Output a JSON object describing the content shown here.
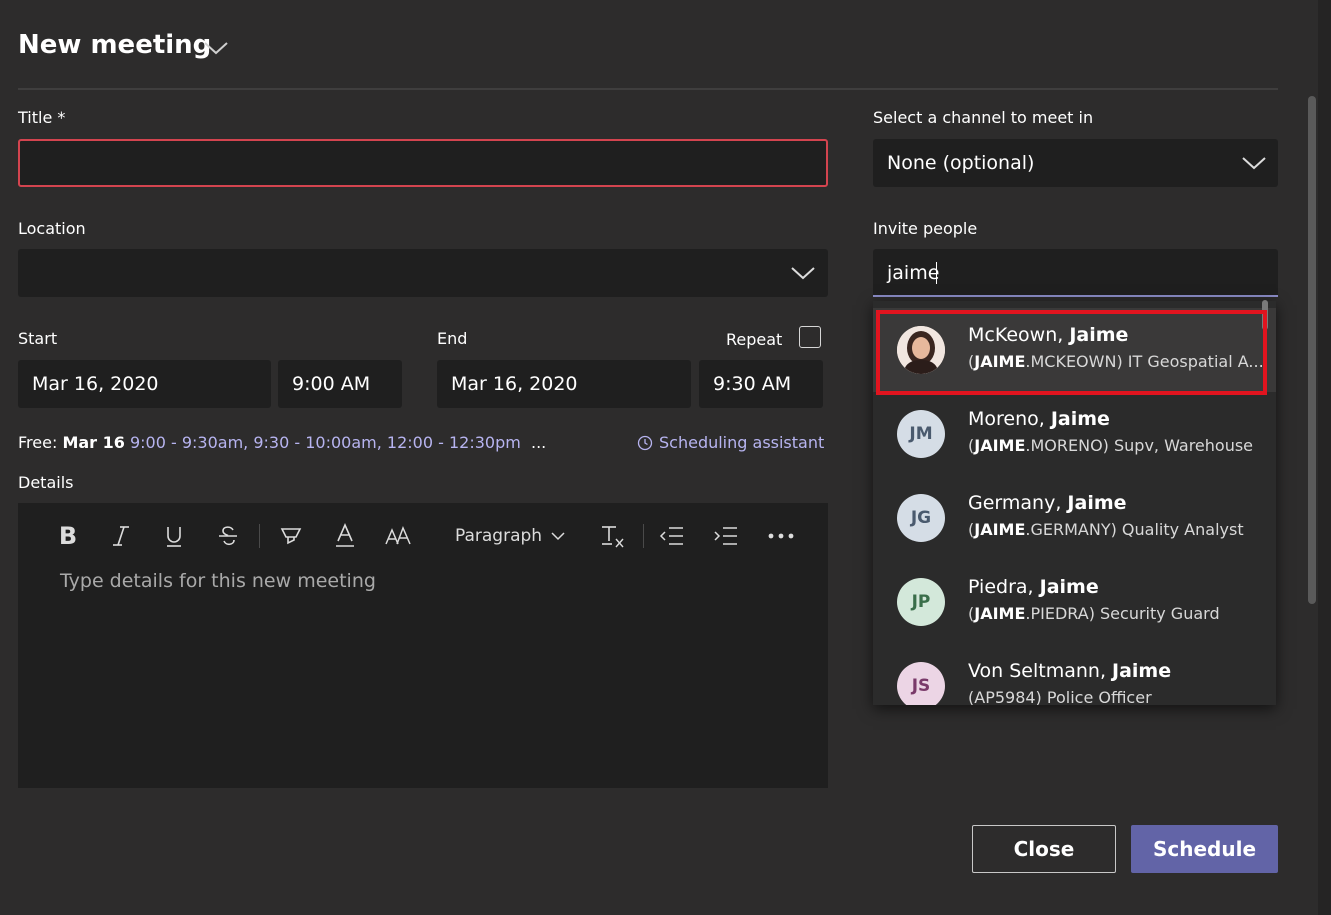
{
  "header": {
    "title": "New meeting"
  },
  "title_field": {
    "label": "Title *",
    "value": ""
  },
  "location_field": {
    "label": "Location",
    "value": ""
  },
  "channel_field": {
    "label": "Select a channel to meet in",
    "value": "None (optional)"
  },
  "invite_field": {
    "label": "Invite people",
    "value": "jaime"
  },
  "start": {
    "label": "Start",
    "date": "Mar 16, 2020",
    "time": "9:00 AM"
  },
  "end": {
    "label": "End",
    "date": "Mar 16, 2020",
    "time": "9:30 AM"
  },
  "repeat": {
    "label": "Repeat",
    "checked": false
  },
  "free": {
    "prefix": "Free:",
    "day": "Mar 16",
    "slots": [
      "9:00 - 9:30am,",
      "9:30 - 10:00am,",
      "12:00 - 12:30pm"
    ],
    "more": "..."
  },
  "scheduling_assistant": {
    "label": "Scheduling assistant"
  },
  "details": {
    "label": "Details",
    "placeholder": "Type details for this new meeting",
    "paragraph_label": "Paragraph"
  },
  "suggestions": [
    {
      "surname": "McKeown,",
      "given": "Jaime",
      "sub_bold": "JAIME",
      "sub_rest": ".MCKEOWN) IT Geospatial A...",
      "initials": "",
      "photo": true,
      "avatar_bg": "#e8d6cf",
      "avatar_fg": "#5a3a2a",
      "selected": true
    },
    {
      "surname": "Moreno,",
      "given": "Jaime",
      "sub_bold": "JAIME",
      "sub_rest": ".MORENO) Supv, Warehouse",
      "initials": "JM",
      "photo": false,
      "avatar_bg": "#d5dde6",
      "avatar_fg": "#4a5a6e",
      "selected": false
    },
    {
      "surname": "Germany,",
      "given": "Jaime",
      "sub_bold": "JAIME",
      "sub_rest": ".GERMANY) Quality Analyst",
      "initials": "JG",
      "photo": false,
      "avatar_bg": "#d5dde6",
      "avatar_fg": "#4a5a6e",
      "selected": false
    },
    {
      "surname": "Piedra,",
      "given": "Jaime",
      "sub_bold": "JAIME",
      "sub_rest": ".PIEDRA) Security Guard",
      "initials": "JP",
      "photo": false,
      "avatar_bg": "#d3e8da",
      "avatar_fg": "#3a6e4a",
      "selected": false
    },
    {
      "surname": "Von Seltmann,",
      "given": "Jaime",
      "sub_bold": "",
      "sub_rest": "(AP5984) Police Officer",
      "initials": "JS",
      "photo": false,
      "avatar_bg": "#ecd5e5",
      "avatar_fg": "#7a3a6a",
      "selected": false
    }
  ],
  "footer": {
    "close_label": "Close",
    "schedule_label": "Schedule"
  },
  "colors": {
    "accent": "#6264a7",
    "error_border": "#d3444f",
    "highlight": "#e1141f",
    "link": "#b7b4f0"
  }
}
